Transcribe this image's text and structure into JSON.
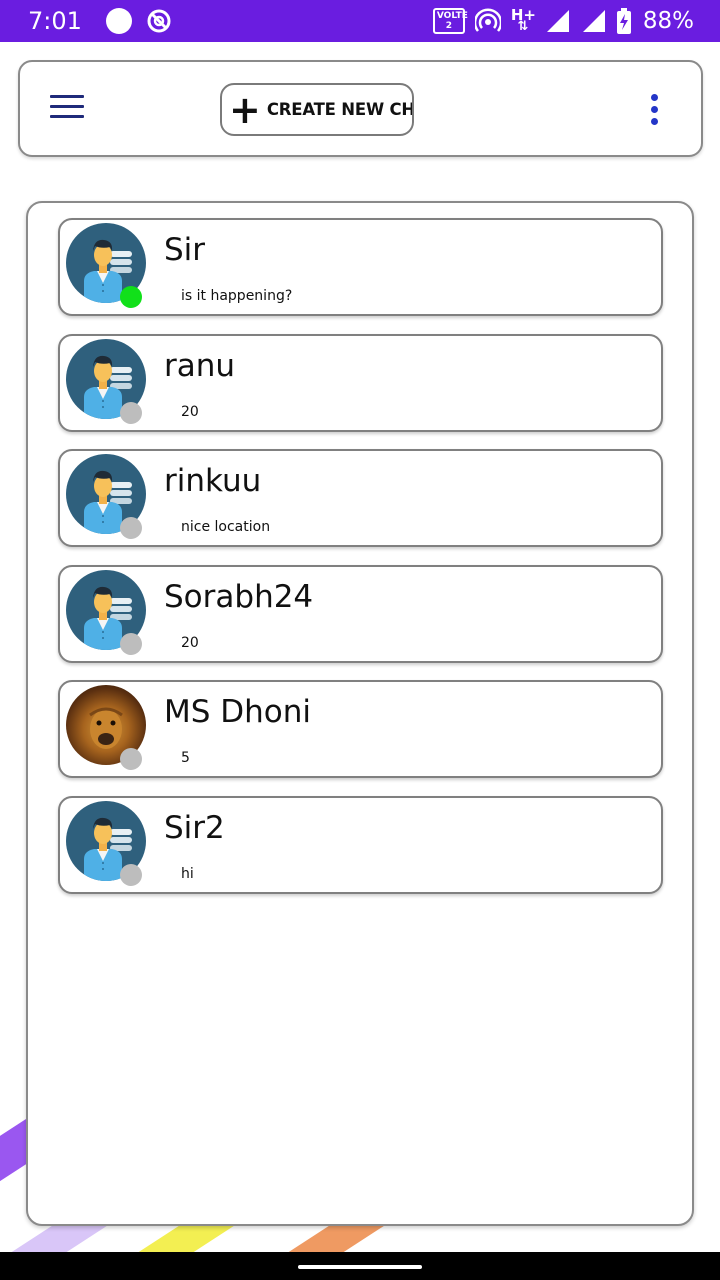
{
  "status_bar": {
    "time": "7:01",
    "volte_label": "VOLTE",
    "volte_sub": "2",
    "network_type": "H+",
    "battery": "88%"
  },
  "toolbar": {
    "create_chat_label": "CREATE NEW CHAT",
    "menu_icon": "hamburger-menu-icon",
    "more_icon": "more-vert-icon"
  },
  "chats": [
    {
      "name": "Sir",
      "preview": "is it happening?",
      "online": true,
      "avatar": "default-user-avatar"
    },
    {
      "name": "ranu",
      "preview": "20",
      "online": false,
      "avatar": "default-user-avatar"
    },
    {
      "name": "rinkuu",
      "preview": "nice location",
      "online": false,
      "avatar": "default-user-avatar"
    },
    {
      "name": "Sorabh24",
      "preview": "20",
      "online": false,
      "avatar": "default-user-avatar"
    },
    {
      "name": "MS Dhoni",
      "preview": "5",
      "online": false,
      "avatar": "lion-photo-avatar"
    },
    {
      "name": "Sir2",
      "preview": "hi",
      "online": false,
      "avatar": "default-user-avatar"
    }
  ],
  "colors": {
    "status_bar": "#6a1de0",
    "online": "#11e01a",
    "offline": "#bdbdbd",
    "accent_blue": "#2436c8",
    "avatar_bg": "#2f607d"
  }
}
